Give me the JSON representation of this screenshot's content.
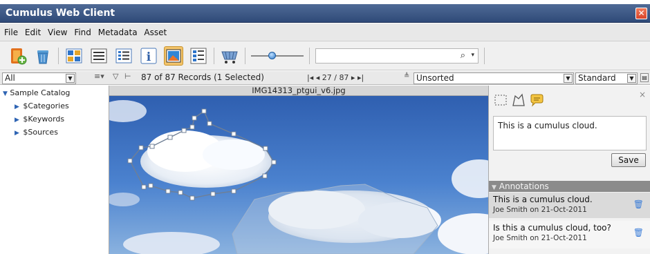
{
  "window": {
    "title": "Cumulus Web Client",
    "close_label": "✕"
  },
  "menu": [
    "File",
    "Edit",
    "View",
    "Find",
    "Metadata",
    "Asset"
  ],
  "toolbar": {
    "search_value": "",
    "search_icon": "⌕",
    "zoom_level": 0.38
  },
  "status": {
    "filter_value": "All",
    "records": "87 of 87 Records (1 Selected)",
    "pager": "|◂  ◂  27 / 87  ▸  ▸|",
    "sort_value": "Unsorted",
    "view_value": "Standard"
  },
  "tree": {
    "root": "Sample Catalog",
    "children": [
      "$Categories",
      "$Keywords",
      "$Sources"
    ]
  },
  "image": {
    "filename": "IMG14313_ptgui_v6.jpg"
  },
  "annotations_panel": {
    "note_text": "This is a cumulus cloud.",
    "save_label": "Save",
    "close_label": "×",
    "header": "Annotations",
    "items": [
      {
        "text": "This is a cumulus cloud.",
        "by": "Joe Smith on 21-Oct-2011"
      },
      {
        "text": "Is this a cumulus cloud, too?",
        "by": "Joe Smith on 21-Oct-2011"
      }
    ]
  },
  "colors": {
    "titlebar": "#3a5584",
    "accent": "#3b7dd8",
    "active_tool": "#f3c46b"
  }
}
